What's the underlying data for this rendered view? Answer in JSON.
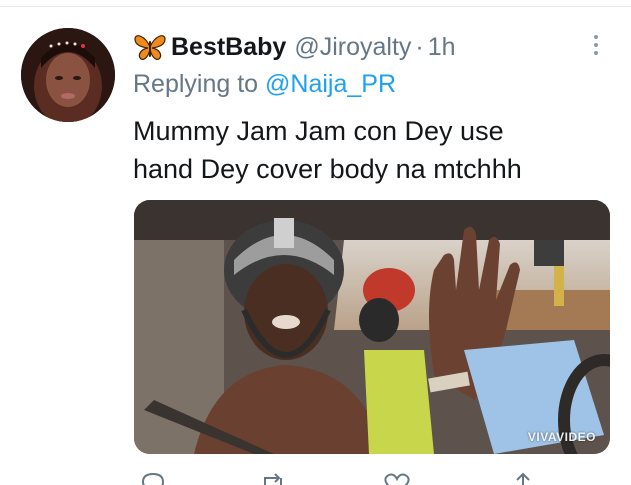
{
  "tweet": {
    "display_name": "BestBaby",
    "name_emoji": "butterfly-icon",
    "handle": "@Jiroyalty",
    "separator": "·",
    "time": "1h",
    "reply_prefix": "Replying to",
    "reply_to": "@Naija_PR",
    "text_line1": "Mummy Jam Jam con Dey use",
    "text_line2": "hand Dey cover body na mtchhh",
    "media_watermark": "VIVAVIDEO",
    "actions": [
      "reply-icon",
      "retweet-icon",
      "like-icon",
      "share-icon"
    ]
  },
  "colors": {
    "text": "#14171a",
    "secondary": "#657786",
    "link": "#1da1f2",
    "divider": "#e6ecf0"
  }
}
